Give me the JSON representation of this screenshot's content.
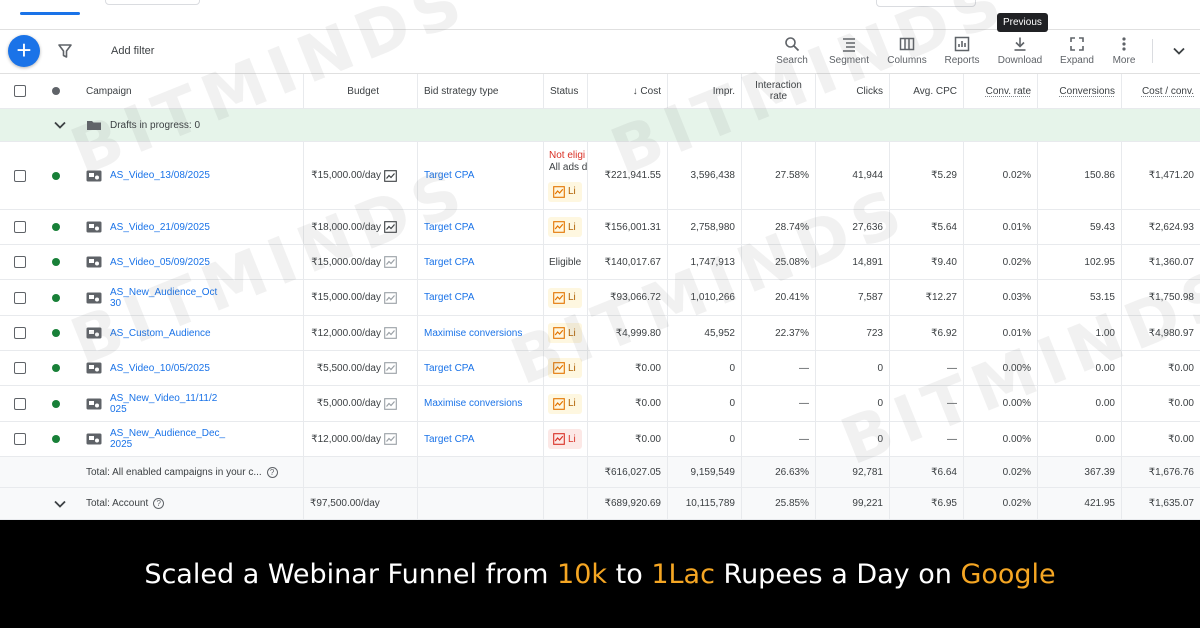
{
  "tooltip": "Previous",
  "toolbar": {
    "add_filter": "Add filter",
    "buttons": [
      {
        "label": "Search",
        "icon": "search-icon"
      },
      {
        "label": "Segment",
        "icon": "segment-icon"
      },
      {
        "label": "Columns",
        "icon": "columns-icon"
      },
      {
        "label": "Reports",
        "icon": "reports-icon"
      },
      {
        "label": "Download",
        "icon": "download-icon"
      },
      {
        "label": "Expand",
        "icon": "expand-icon"
      },
      {
        "label": "More",
        "icon": "more-icon"
      }
    ]
  },
  "table": {
    "headers": {
      "campaign": "Campaign",
      "budget": "Budget",
      "bid_strategy": "Bid strategy type",
      "status": "Status",
      "cost": "↓ Cost",
      "impr": "Impr.",
      "interaction_rate": "Interaction rate",
      "clicks": "Clicks",
      "avg_cpc": "Avg. CPC",
      "conv_rate": "Conv. rate",
      "conversions": "Conversions",
      "cost_conv": "Cost / conv."
    },
    "drafts": "Drafts in progress: 0",
    "rows": [
      {
        "campaign": "AS_Video_13/08/2025",
        "budget": "₹15,000.00/day",
        "bid": "Target CPA",
        "status_type": "noteligible",
        "status_line1": "Not eligi",
        "status_line2": "All ads d",
        "status_badge": "Li",
        "cost": "₹221,941.55",
        "impr": "3,596,438",
        "ir": "27.58%",
        "clicks": "41,944",
        "cpc": "₹5.29",
        "cr": "0.02%",
        "conv": "150.86",
        "cpconv": "₹1,471.20"
      },
      {
        "campaign": "AS_Video_21/09/2025",
        "budget": "₹18,000.00/day",
        "bid": "Target CPA",
        "status_type": "badge",
        "status_badge": "Li",
        "cost": "₹156,001.31",
        "impr": "2,758,980",
        "ir": "28.74%",
        "clicks": "27,636",
        "cpc": "₹5.64",
        "cr": "0.01%",
        "conv": "59.43",
        "cpconv": "₹2,624.93"
      },
      {
        "campaign": "AS_Video_05/09/2025",
        "budget": "₹15,000.00/day",
        "bid": "Target CPA",
        "status_type": "text",
        "status_text": "Eligible",
        "cost": "₹140,017.67",
        "impr": "1,747,913",
        "ir": "25.08%",
        "clicks": "14,891",
        "cpc": "₹9.40",
        "cr": "0.02%",
        "conv": "102.95",
        "cpconv": "₹1,360.07"
      },
      {
        "campaign": "AS_New_Audience_Oct 30",
        "budget": "₹15,000.00/day",
        "bid": "Target CPA",
        "status_type": "badge",
        "status_badge": "Li",
        "cost": "₹93,066.72",
        "impr": "1,010,266",
        "ir": "20.41%",
        "clicks": "7,587",
        "cpc": "₹12.27",
        "cr": "0.03%",
        "conv": "53.15",
        "cpconv": "₹1,750.98"
      },
      {
        "campaign": "AS_Custom_Audience",
        "budget": "₹12,000.00/day",
        "bid": "Maximise conversions",
        "status_type": "badge",
        "status_badge": "Li",
        "cost": "₹4,999.80",
        "impr": "45,952",
        "ir": "22.37%",
        "clicks": "723",
        "cpc": "₹6.92",
        "cr": "0.01%",
        "conv": "1.00",
        "cpconv": "₹4,980.97"
      },
      {
        "campaign": "AS_Video_10/05/2025",
        "budget": "₹5,500.00/day",
        "bid": "Target CPA",
        "status_type": "badge",
        "status_badge": "Li",
        "cost": "₹0.00",
        "impr": "0",
        "ir": "—",
        "clicks": "0",
        "cpc": "—",
        "cr": "0.00%",
        "conv": "0.00",
        "cpconv": "₹0.00"
      },
      {
        "campaign": "AS_New_Video_11/11/2 025",
        "budget": "₹5,000.00/day",
        "bid": "Maximise conversions",
        "status_type": "badge",
        "status_badge": "Li",
        "cost": "₹0.00",
        "impr": "0",
        "ir": "—",
        "clicks": "0",
        "cpc": "—",
        "cr": "0.00%",
        "conv": "0.00",
        "cpconv": "₹0.00"
      },
      {
        "campaign": "AS_New_Audience_Dec_ 2025",
        "budget": "₹12,000.00/day",
        "bid": "Target CPA",
        "status_type": "badge_red",
        "status_badge": "Li",
        "cost": "₹0.00",
        "impr": "0",
        "ir": "—",
        "clicks": "0",
        "cpc": "—",
        "cr": "0.00%",
        "conv": "0.00",
        "cpconv": "₹0.00"
      }
    ],
    "total_enabled": {
      "label": "Total: All enabled campaigns in your c...",
      "cost": "₹616,027.05",
      "impr": "9,159,549",
      "ir": "26.63%",
      "clicks": "92,781",
      "cpc": "₹6.64",
      "cr": "0.02%",
      "conv": "367.39",
      "cpconv": "₹1,676.76"
    },
    "total_account": {
      "label": "Total: Account",
      "budget": "₹97,500.00/day",
      "cost": "₹689,920.69",
      "impr": "10,115,789",
      "ir": "25.85%",
      "clicks": "99,221",
      "cpc": "₹6.95",
      "cr": "0.02%",
      "conv": "421.95",
      "cpconv": "₹1,635.07"
    }
  },
  "watermark": "BITMINDS",
  "banner": {
    "p1": "Scaled a Webinar Funnel from ",
    "h1": "10k",
    "p2": " to ",
    "h2": "1Lac",
    "p3": " Rupees a Day on ",
    "h3": "Google"
  },
  "colors": {
    "accent": "#1a73e8",
    "highlight": "#f5a623",
    "enabled": "#188038",
    "drafts_bg": "#e6f4ea"
  }
}
